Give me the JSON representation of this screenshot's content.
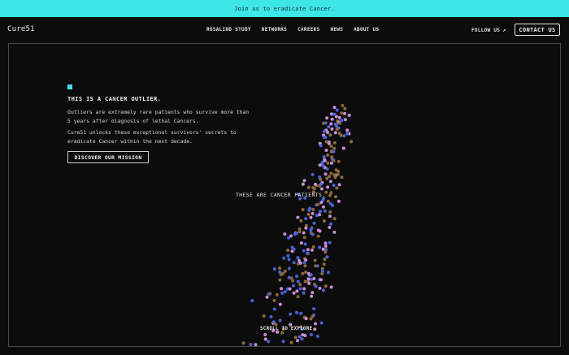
{
  "banner": {
    "text": "Join us to eradicate Cancer."
  },
  "nav": {
    "logo": "Cure51",
    "links": [
      "ROSALIND STUDY",
      "NETWORKS",
      "CAREERS",
      "NEWS",
      "ABOUT US"
    ],
    "follow_label": "FOLLOW US",
    "follow_icon": "arrow-up-right-icon",
    "contact_label": "CONTACT US"
  },
  "hero": {
    "headline": "THIS IS A CANCER OUTLIER.",
    "paragraph1": "Outliers are extremely rare patients who survive more than 5 years after diagnosis of lethal Cancers.",
    "paragraph2": "Cure51 unlocks these exceptional survivors' secrets to eradicate Cancer within the next decade.",
    "cta_label": "DISCOVER OUR MISSION",
    "marker_color": "#3fe6e8"
  },
  "visual": {
    "patients_label": "THESE ARE CANCER PATIENTS.",
    "scroll_label": "SCROLL TO EXPLORE",
    "dot_colors": [
      "#4a63d6",
      "#c98fd6",
      "#8a6a3a"
    ]
  },
  "colors": {
    "accent": "#3fe6e8",
    "background": "#0c0c0c",
    "frame_border": "#4a4a4a"
  }
}
